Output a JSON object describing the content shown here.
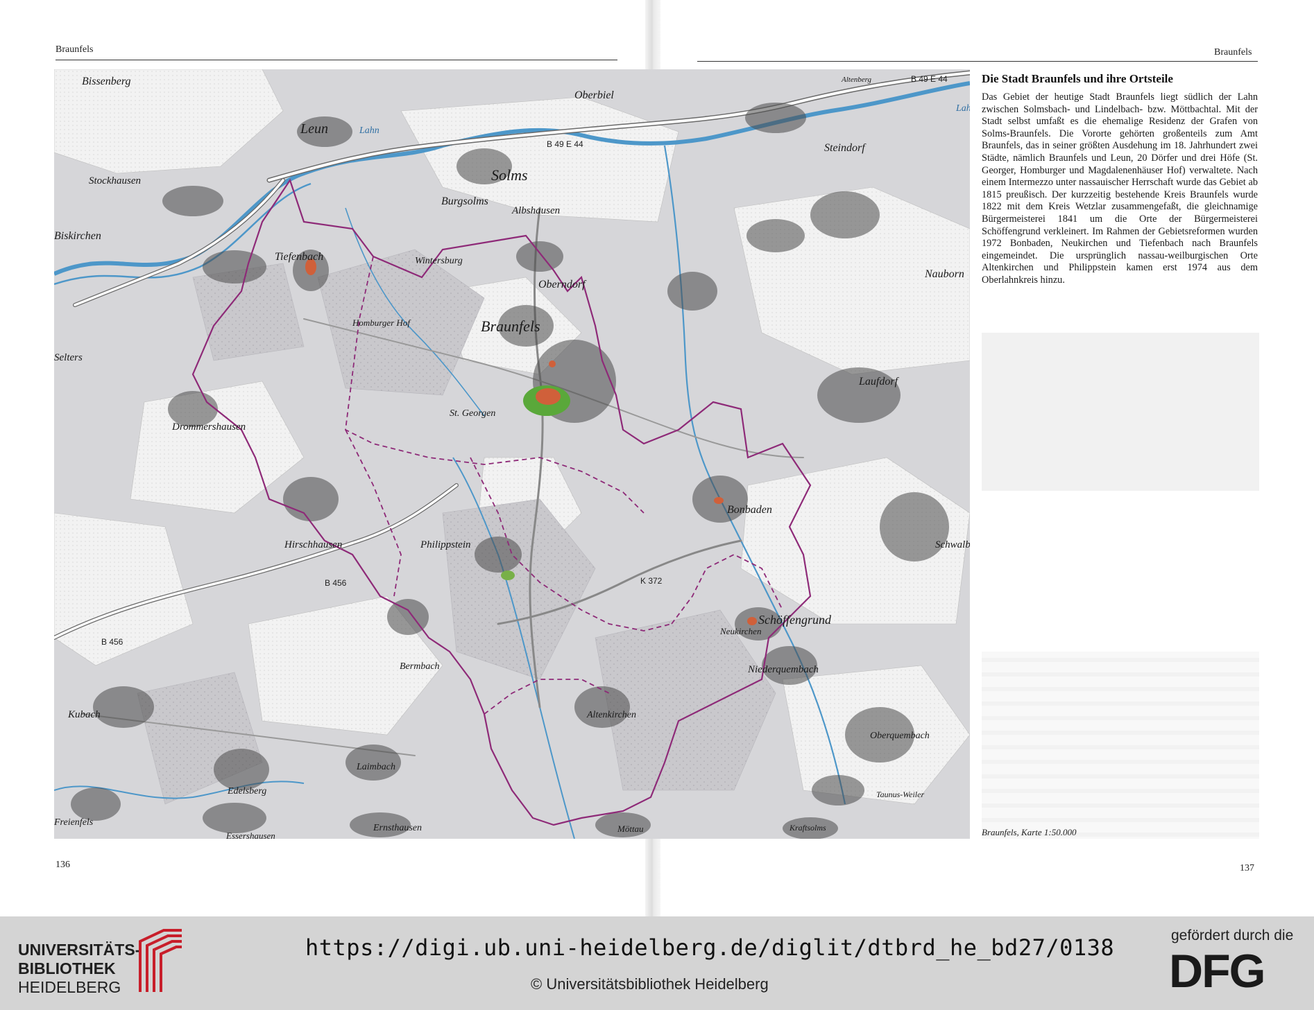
{
  "left_page": {
    "running_head": "Braunfels",
    "page_number": "136"
  },
  "right_page": {
    "running_head": "Braunfels",
    "page_number": "137",
    "heading": "Die Stadt Braunfels und ihre Ortsteile",
    "body": "Das Gebiet der heutige Stadt Braunfels liegt südlich der Lahn zwischen Solmsbach- und Lindelbach- bzw. Möttbachtal. Mit der Stadt selbst umfaßt es die ehemalige Residenz der Grafen von Solms-Braunfels. Die Vororte gehörten großenteils zum Amt Braunfels, das in seiner größten Ausdehung im 18. Jahrhundert zwei Städte, nämlich Braunfels und Leun, 20 Dörfer und drei Höfe (St. Georger, Homburger und Magdalenenhäuser Hof) verwaltete. Nach einem Intermezzo unter nassauischer Herrschaft wurde das Gebiet ab 1815 preußisch. Der kurzzeitig bestehende Kreis Braunfels wurde 1822 mit dem Kreis Wetzlar zusammengefaßt, die gleichnamige Bürgermeisterei 1841 um die Orte der Bürgermeisterei Schöffengrund verkleinert. Im Rahmen der Gebietsreformen wurden 1972 Bonbaden, Neukirchen und Tiefenbach nach Braunfels eingemeindet. Die ursprünglich nassau-weilburgischen Orte Altenkirchen und Philippstein kamen erst 1974 aus dem Oberlahnkreis hinzu.",
    "caption": "Braunfels, Karte 1:50.000"
  },
  "map": {
    "places": [
      {
        "name": "Bissenberg"
      },
      {
        "name": "Leun"
      },
      {
        "name": "Oberbiel"
      },
      {
        "name": "Altenberg"
      },
      {
        "name": "Stockhausen"
      },
      {
        "name": "Solms"
      },
      {
        "name": "Steindorf"
      },
      {
        "name": "Biskirchen"
      },
      {
        "name": "Burgsolms"
      },
      {
        "name": "Albshausen"
      },
      {
        "name": "Tiefenbach"
      },
      {
        "name": "Wintersburg"
      },
      {
        "name": "Oberndorf"
      },
      {
        "name": "Nauborn"
      },
      {
        "name": "Braunfels"
      },
      {
        "name": "Homburger Hof"
      },
      {
        "name": "Selters"
      },
      {
        "name": "St. Georgen"
      },
      {
        "name": "Laufdorf"
      },
      {
        "name": "Drommershausen"
      },
      {
        "name": "Bonbaden"
      },
      {
        "name": "Hirschhausen"
      },
      {
        "name": "Philippstein"
      },
      {
        "name": "Schwalbach"
      },
      {
        "name": "Neukirchen"
      },
      {
        "name": "Schöffengrund"
      },
      {
        "name": "Bermbach"
      },
      {
        "name": "Niederquembach"
      },
      {
        "name": "Kubach"
      },
      {
        "name": "Altenkirchen"
      },
      {
        "name": "Oberquembach"
      },
      {
        "name": "Laimbach"
      },
      {
        "name": "Edelsberg"
      },
      {
        "name": "Taunus-Weiler"
      },
      {
        "name": "Freienfels"
      },
      {
        "name": "Essershausen"
      },
      {
        "name": "Ernsthausen"
      },
      {
        "name": "Möttau"
      },
      {
        "name": "Kraftsolms"
      }
    ],
    "waters": [
      {
        "name": "Lahn"
      },
      {
        "name": "Lahn"
      }
    ],
    "roads": [
      {
        "name": "B 49  E 44"
      },
      {
        "name": "B 49  E 44"
      },
      {
        "name": "B 456"
      },
      {
        "name": "B 456"
      },
      {
        "name": "K 372"
      }
    ],
    "colors": {
      "terrain": "#d6d6d9",
      "forest": "#c9c8cc",
      "field": "#f1f1f1",
      "water": "#4d97c9",
      "boundary": "#8e2a78",
      "settlement": "#4a4a4a",
      "road": "#ffffff",
      "castle_park": "#5aa83a",
      "historic_core": "#d0603a"
    }
  },
  "footer": {
    "institution_line1": "UNIVERSITÄTS-",
    "institution_line2": "BIBLIOTHEK",
    "institution_line3": "HEIDELBERG",
    "url": "https://digi.ub.uni-heidelberg.de/diglit/dtbrd_he_bd27/0138",
    "copyright": "© Universitätsbibliothek Heidelberg",
    "funder_label": "gefördert durch die",
    "funder_logo": "DFG"
  }
}
